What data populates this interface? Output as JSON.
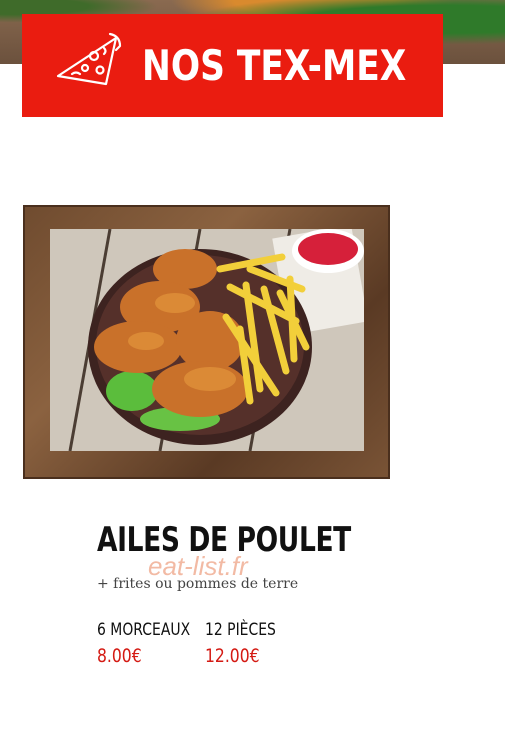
{
  "header": {
    "title": "NOS TEX-MEX",
    "icon": "pizza-slice-icon",
    "banner_color": "#ea1c10"
  },
  "dish": {
    "name": "AILES DE POULET",
    "description": "+ frites ou pommes de terre",
    "image": "chicken-wings-fries-photo",
    "prices": [
      {
        "label": "6 MORCEAUX",
        "price": "8.00€"
      },
      {
        "label": "12 PIÈCES",
        "price": "12.00€"
      }
    ]
  },
  "watermark": "eat-list.fr",
  "colors": {
    "price": "#d41a13",
    "accent": "#ea1c10"
  }
}
